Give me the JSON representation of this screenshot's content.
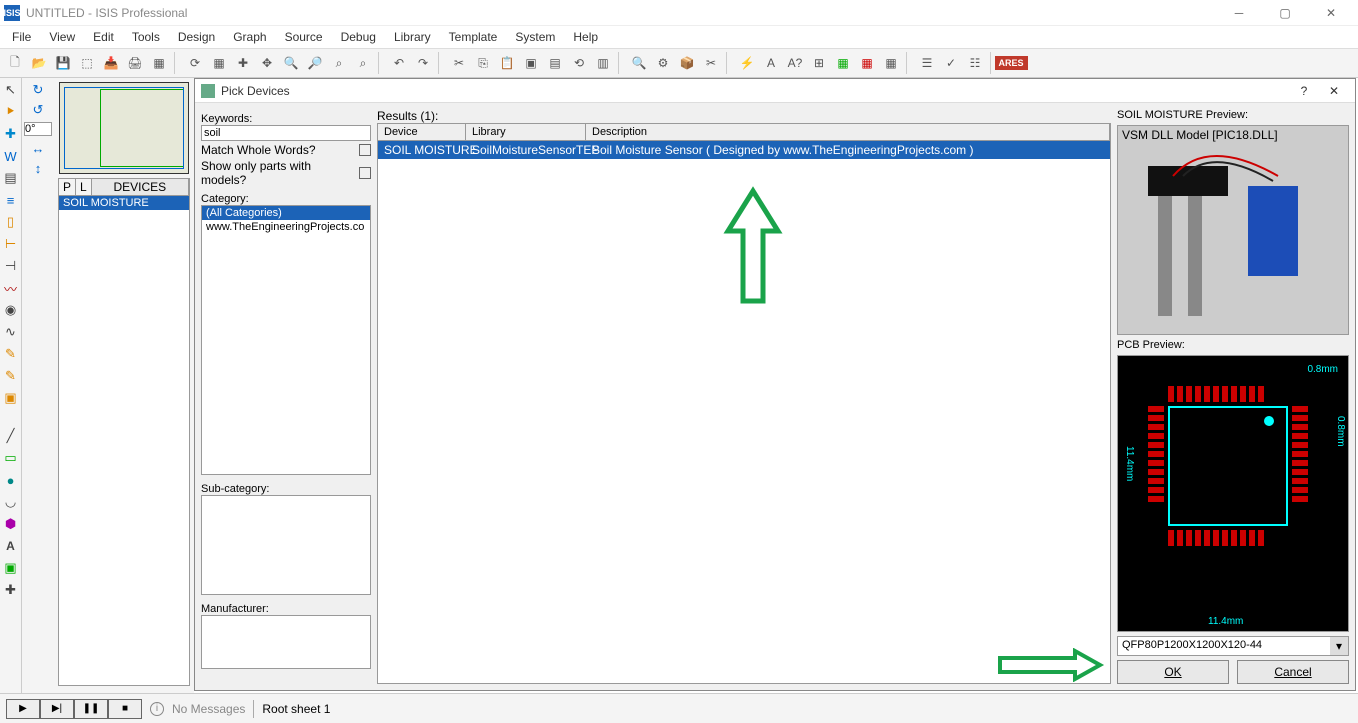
{
  "window": {
    "title": "UNTITLED - ISIS Professional",
    "app_badge": "ISIS"
  },
  "menu": [
    "File",
    "View",
    "Edit",
    "Tools",
    "Design",
    "Graph",
    "Source",
    "Debug",
    "Library",
    "Template",
    "System",
    "Help"
  ],
  "rotation_value": "0°",
  "device_panel": {
    "col_p": "P",
    "col_l": "L",
    "col_dev": "DEVICES",
    "rows": [
      "SOIL MOISTURE"
    ]
  },
  "dialog": {
    "title": "Pick Devices",
    "keywords_label": "Keywords:",
    "keywords_value": "soil",
    "match_whole_label": "Match Whole Words?",
    "models_only_label": "Show only parts with models?",
    "category_label": "Category:",
    "category_items": [
      "(All Categories)",
      "www.TheEngineeringProjects.co"
    ],
    "subcat_label": "Sub-category:",
    "manuf_label": "Manufacturer:",
    "results_label": "Results (1):",
    "col_device": "Device",
    "col_library": "Library",
    "col_desc": "Description",
    "row_device": "SOIL MOISTURE",
    "row_library": "SoilMoistureSensorTEP",
    "row_desc": "Soil Moisture Sensor ( Designed by www.TheEngineeringProjects.com )",
    "schem_label": "SOIL MOISTURE Preview:",
    "schem_sub": "VSM DLL Model [PIC18.DLL]",
    "pcb_label": "PCB Preview:",
    "package_value": "QFP80P1200X1200X120-44",
    "pcb_dim1": "0.8mm",
    "pcb_dim2": "11.4mm",
    "pcb_dim3": "11.4mm",
    "pcb_dim4": "0.8mm",
    "ok": "OK",
    "cancel": "Cancel"
  },
  "status": {
    "no_messages": "No Messages",
    "sheet": "Root sheet 1"
  },
  "ares": "ARES"
}
